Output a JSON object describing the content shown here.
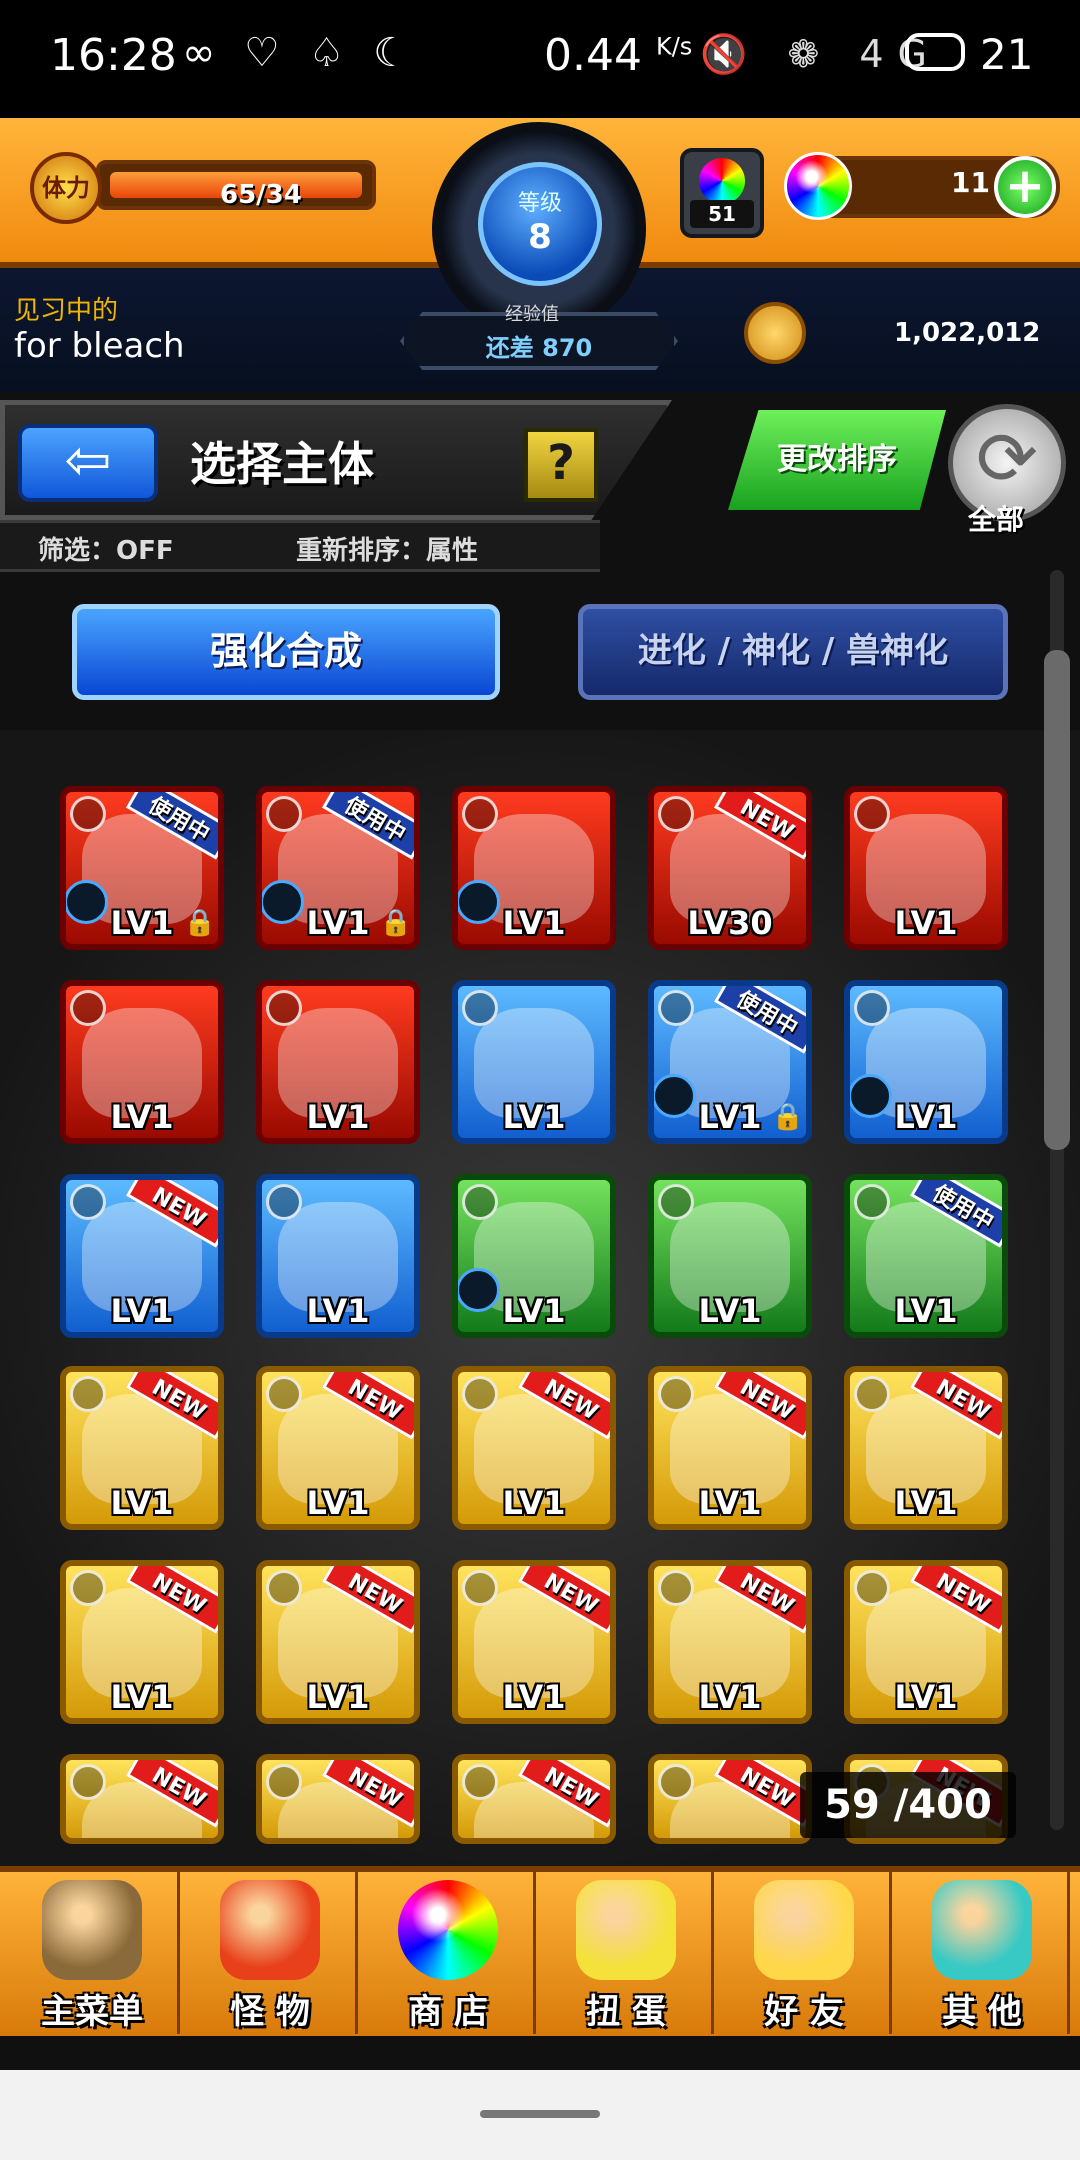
{
  "status_bar": {
    "time": "16:28",
    "left_icons": "∞ ♡ ♤ ☾",
    "network_speed": "0.44",
    "network_unit": "K/s",
    "right_icons": "🔇 ❁ 4G",
    "battery": "21"
  },
  "header": {
    "stamina_label": "体力",
    "stamina_value": "65/34",
    "stamina_fraction": 1.0,
    "level_label": "等级",
    "level_value": "8",
    "exp_title": "经验值",
    "exp_value": "还差 870",
    "stone_count": "51",
    "gem_count": "11",
    "plus_label": "+",
    "rank_label": "见习中的",
    "player_name": "for bleach",
    "coin_count": "1,022,012"
  },
  "select": {
    "back_label": "⇦",
    "title": "选择主体",
    "help_label": "?",
    "filter_label": "筛选：OFF",
    "reorder_label": "重新排序：属性",
    "change_sort_label": "更改排序",
    "refresh_label": "全部",
    "refresh_icon": "⟳"
  },
  "tabs": {
    "enhance": "强化合成",
    "evolve": "进化 / 神化 / 兽神化"
  },
  "monsters": [
    {
      "element": "fire",
      "level": "LV1",
      "badge": "使用中",
      "lock": true,
      "orb": true
    },
    {
      "element": "fire",
      "level": "LV1",
      "badge": "使用中",
      "lock": true,
      "orb": true
    },
    {
      "element": "fire",
      "level": "LV1",
      "badge": "",
      "lock": false,
      "orb": true
    },
    {
      "element": "fire",
      "level": "LV30",
      "badge": "NEW",
      "lock": false,
      "orb": false
    },
    {
      "element": "fire",
      "level": "LV1",
      "badge": "",
      "lock": false,
      "orb": false
    },
    {
      "element": "fire",
      "level": "LV1",
      "badge": "",
      "lock": false,
      "orb": false
    },
    {
      "element": "fire",
      "level": "LV1",
      "badge": "",
      "lock": false,
      "orb": false
    },
    {
      "element": "water",
      "level": "LV1",
      "badge": "",
      "lock": false,
      "orb": false
    },
    {
      "element": "water",
      "level": "LV1",
      "badge": "使用中",
      "lock": true,
      "orb": true
    },
    {
      "element": "water",
      "level": "LV1",
      "badge": "",
      "lock": false,
      "orb": true
    },
    {
      "element": "water",
      "level": "LV1",
      "badge": "NEW",
      "lock": false,
      "orb": false
    },
    {
      "element": "water",
      "level": "LV1",
      "badge": "",
      "lock": false,
      "orb": false
    },
    {
      "element": "wood",
      "level": "LV1",
      "badge": "",
      "lock": false,
      "orb": true
    },
    {
      "element": "wood",
      "level": "LV1",
      "badge": "",
      "lock": false,
      "orb": false
    },
    {
      "element": "wood",
      "level": "LV1",
      "badge": "使用中",
      "lock": false,
      "orb": false
    },
    {
      "element": "light",
      "level": "LV1",
      "badge": "NEW",
      "lock": false,
      "orb": false
    },
    {
      "element": "light",
      "level": "LV1",
      "badge": "NEW",
      "lock": false,
      "orb": false
    },
    {
      "element": "light",
      "level": "LV1",
      "badge": "NEW",
      "lock": false,
      "orb": false
    },
    {
      "element": "light",
      "level": "LV1",
      "badge": "NEW",
      "lock": false,
      "orb": false
    },
    {
      "element": "light",
      "level": "LV1",
      "badge": "NEW",
      "lock": false,
      "orb": false
    },
    {
      "element": "light",
      "level": "LV1",
      "badge": "NEW",
      "lock": false,
      "orb": false
    },
    {
      "element": "light",
      "level": "LV1",
      "badge": "NEW",
      "lock": false,
      "orb": false
    },
    {
      "element": "light",
      "level": "LV1",
      "badge": "NEW",
      "lock": false,
      "orb": false
    },
    {
      "element": "light",
      "level": "LV1",
      "badge": "NEW",
      "lock": false,
      "orb": false
    },
    {
      "element": "light",
      "level": "LV1",
      "badge": "NEW",
      "lock": false,
      "orb": false
    },
    {
      "element": "light",
      "level": "",
      "badge": "NEW",
      "lock": false,
      "orb": false
    },
    {
      "element": "light",
      "level": "",
      "badge": "NEW",
      "lock": false,
      "orb": false
    },
    {
      "element": "light",
      "level": "",
      "badge": "NEW",
      "lock": false,
      "orb": false
    },
    {
      "element": "light",
      "level": "",
      "badge": "NEW",
      "lock": false,
      "orb": false
    },
    {
      "element": "light",
      "level": "",
      "badge": "NEW",
      "lock": false,
      "orb": false
    }
  ],
  "box_count": "59 /400",
  "nav": [
    {
      "label": "主菜单",
      "icon": "castle-gate-icon",
      "color": "#8a6a3a"
    },
    {
      "label": "怪 物",
      "icon": "red-dragon-icon",
      "color": "#e8401a"
    },
    {
      "label": "商 店",
      "icon": "rainbow-orb-icon",
      "color": "#c45cff"
    },
    {
      "label": "扭 蛋",
      "icon": "egg-icon",
      "color": "#f4e23a"
    },
    {
      "label": "好 友",
      "icon": "friends-icon",
      "color": "#ffd84a"
    },
    {
      "label": "其 他",
      "icon": "question-diamond-icon",
      "color": "#39c9c4"
    }
  ]
}
